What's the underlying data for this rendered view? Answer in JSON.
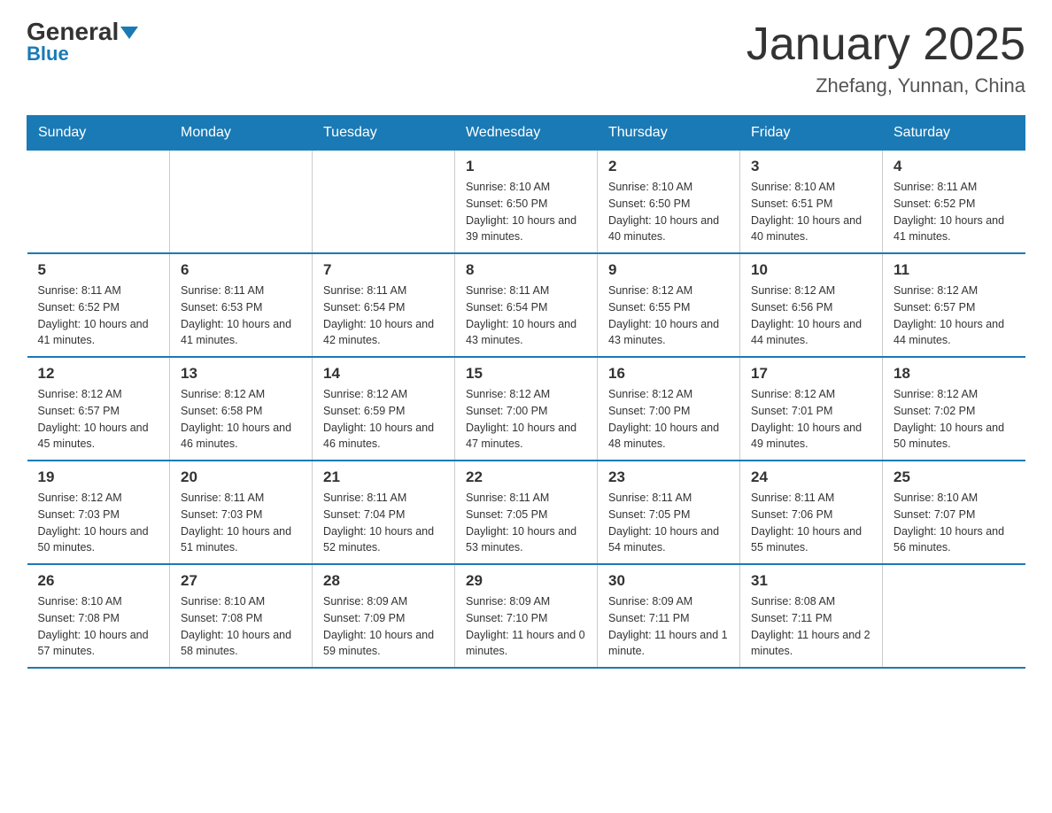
{
  "logo": {
    "general": "General",
    "blue": "Blue"
  },
  "title": "January 2025",
  "location": "Zhefang, Yunnan, China",
  "weekdays": [
    "Sunday",
    "Monday",
    "Tuesday",
    "Wednesday",
    "Thursday",
    "Friday",
    "Saturday"
  ],
  "weeks": [
    [
      {
        "day": "",
        "info": ""
      },
      {
        "day": "",
        "info": ""
      },
      {
        "day": "",
        "info": ""
      },
      {
        "day": "1",
        "info": "Sunrise: 8:10 AM\nSunset: 6:50 PM\nDaylight: 10 hours and 39 minutes."
      },
      {
        "day": "2",
        "info": "Sunrise: 8:10 AM\nSunset: 6:50 PM\nDaylight: 10 hours and 40 minutes."
      },
      {
        "day": "3",
        "info": "Sunrise: 8:10 AM\nSunset: 6:51 PM\nDaylight: 10 hours and 40 minutes."
      },
      {
        "day": "4",
        "info": "Sunrise: 8:11 AM\nSunset: 6:52 PM\nDaylight: 10 hours and 41 minutes."
      }
    ],
    [
      {
        "day": "5",
        "info": "Sunrise: 8:11 AM\nSunset: 6:52 PM\nDaylight: 10 hours and 41 minutes."
      },
      {
        "day": "6",
        "info": "Sunrise: 8:11 AM\nSunset: 6:53 PM\nDaylight: 10 hours and 41 minutes."
      },
      {
        "day": "7",
        "info": "Sunrise: 8:11 AM\nSunset: 6:54 PM\nDaylight: 10 hours and 42 minutes."
      },
      {
        "day": "8",
        "info": "Sunrise: 8:11 AM\nSunset: 6:54 PM\nDaylight: 10 hours and 43 minutes."
      },
      {
        "day": "9",
        "info": "Sunrise: 8:12 AM\nSunset: 6:55 PM\nDaylight: 10 hours and 43 minutes."
      },
      {
        "day": "10",
        "info": "Sunrise: 8:12 AM\nSunset: 6:56 PM\nDaylight: 10 hours and 44 minutes."
      },
      {
        "day": "11",
        "info": "Sunrise: 8:12 AM\nSunset: 6:57 PM\nDaylight: 10 hours and 44 minutes."
      }
    ],
    [
      {
        "day": "12",
        "info": "Sunrise: 8:12 AM\nSunset: 6:57 PM\nDaylight: 10 hours and 45 minutes."
      },
      {
        "day": "13",
        "info": "Sunrise: 8:12 AM\nSunset: 6:58 PM\nDaylight: 10 hours and 46 minutes."
      },
      {
        "day": "14",
        "info": "Sunrise: 8:12 AM\nSunset: 6:59 PM\nDaylight: 10 hours and 46 minutes."
      },
      {
        "day": "15",
        "info": "Sunrise: 8:12 AM\nSunset: 7:00 PM\nDaylight: 10 hours and 47 minutes."
      },
      {
        "day": "16",
        "info": "Sunrise: 8:12 AM\nSunset: 7:00 PM\nDaylight: 10 hours and 48 minutes."
      },
      {
        "day": "17",
        "info": "Sunrise: 8:12 AM\nSunset: 7:01 PM\nDaylight: 10 hours and 49 minutes."
      },
      {
        "day": "18",
        "info": "Sunrise: 8:12 AM\nSunset: 7:02 PM\nDaylight: 10 hours and 50 minutes."
      }
    ],
    [
      {
        "day": "19",
        "info": "Sunrise: 8:12 AM\nSunset: 7:03 PM\nDaylight: 10 hours and 50 minutes."
      },
      {
        "day": "20",
        "info": "Sunrise: 8:11 AM\nSunset: 7:03 PM\nDaylight: 10 hours and 51 minutes."
      },
      {
        "day": "21",
        "info": "Sunrise: 8:11 AM\nSunset: 7:04 PM\nDaylight: 10 hours and 52 minutes."
      },
      {
        "day": "22",
        "info": "Sunrise: 8:11 AM\nSunset: 7:05 PM\nDaylight: 10 hours and 53 minutes."
      },
      {
        "day": "23",
        "info": "Sunrise: 8:11 AM\nSunset: 7:05 PM\nDaylight: 10 hours and 54 minutes."
      },
      {
        "day": "24",
        "info": "Sunrise: 8:11 AM\nSunset: 7:06 PM\nDaylight: 10 hours and 55 minutes."
      },
      {
        "day": "25",
        "info": "Sunrise: 8:10 AM\nSunset: 7:07 PM\nDaylight: 10 hours and 56 minutes."
      }
    ],
    [
      {
        "day": "26",
        "info": "Sunrise: 8:10 AM\nSunset: 7:08 PM\nDaylight: 10 hours and 57 minutes."
      },
      {
        "day": "27",
        "info": "Sunrise: 8:10 AM\nSunset: 7:08 PM\nDaylight: 10 hours and 58 minutes."
      },
      {
        "day": "28",
        "info": "Sunrise: 8:09 AM\nSunset: 7:09 PM\nDaylight: 10 hours and 59 minutes."
      },
      {
        "day": "29",
        "info": "Sunrise: 8:09 AM\nSunset: 7:10 PM\nDaylight: 11 hours and 0 minutes."
      },
      {
        "day": "30",
        "info": "Sunrise: 8:09 AM\nSunset: 7:11 PM\nDaylight: 11 hours and 1 minute."
      },
      {
        "day": "31",
        "info": "Sunrise: 8:08 AM\nSunset: 7:11 PM\nDaylight: 11 hours and 2 minutes."
      },
      {
        "day": "",
        "info": ""
      }
    ]
  ]
}
